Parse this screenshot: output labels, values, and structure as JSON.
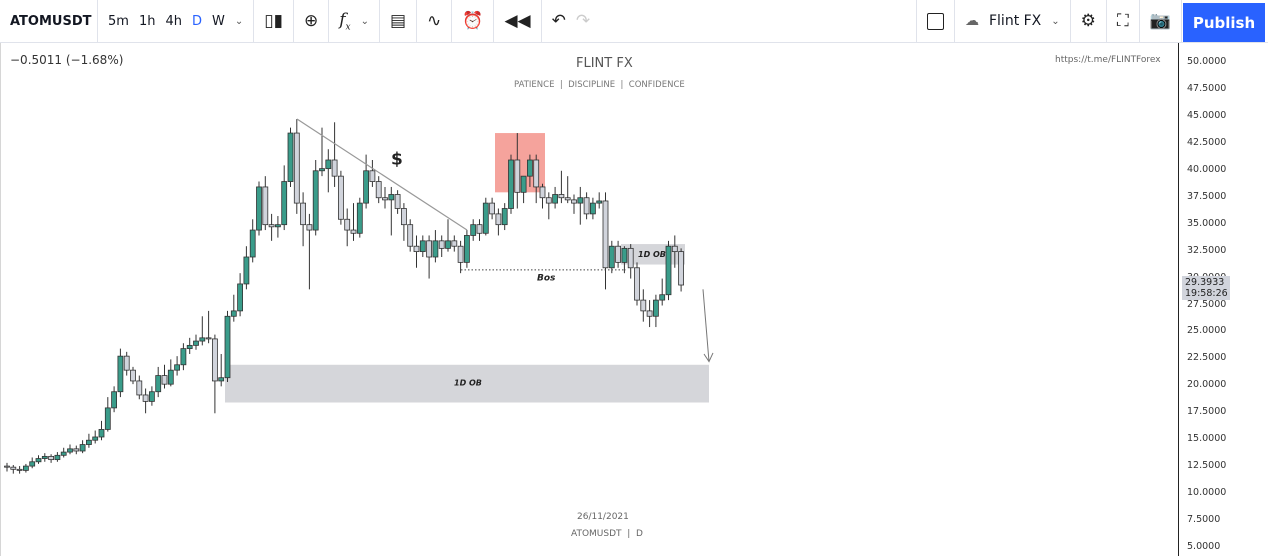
{
  "toolbar": {
    "symbol": "ATOMUSDT",
    "intervals": [
      "5m",
      "1h",
      "4h",
      "D",
      "W"
    ],
    "active_interval": "D",
    "layout_name": "Flint FX",
    "publish": "Publish",
    "icons": [
      "candles-icon",
      "add-compare-icon",
      "indicators-icon",
      "bar-chart-icon",
      "templates-icon",
      "alert-icon",
      "replay-icon",
      "undo-icon",
      "redo-icon",
      "rectangle-icon",
      "cloud-icon",
      "gear-icon",
      "fullscreen-icon",
      "camera-icon"
    ]
  },
  "legend": {
    "change": "−0.5011 (−1.68%)"
  },
  "watermark": {
    "title": "FLINT FX",
    "subtitle": "PATIENCE  |  DISCIPLINE  |  CONFIDENCE",
    "link": "https://t.me/FLINTForex",
    "date": "26/11/2021",
    "symbol_line": "ATOMUSDT  |  D"
  },
  "annotations": {
    "dollar": "$",
    "ob_big": "1D OB",
    "ob_small": "1D OB",
    "bos": "Bos"
  },
  "colors": {
    "up": "#3a9c8a",
    "down": "#d1d4dc",
    "accent": "#2962ff",
    "supply_zone": "#f5a39c",
    "ob_zone": "#d5d6da"
  },
  "chart_data": {
    "type": "candlestick",
    "symbol": "ATOMUSDT",
    "interval": "D",
    "ylim": [
      5,
      50
    ],
    "y_ticks": [
      "50.0000",
      "47.5000",
      "45.0000",
      "42.5000",
      "40.0000",
      "37.5000",
      "35.0000",
      "32.5000",
      "30.0000",
      "27.5000",
      "25.0000",
      "22.5000",
      "20.0000",
      "17.5000",
      "15.0000",
      "12.5000",
      "10.0000",
      "7.5000",
      "5.0000"
    ],
    "last_price": "29.3933",
    "countdown": "19:58:26",
    "ohlc": [
      [
        12.6,
        12.9,
        12.1,
        12.5
      ],
      [
        12.5,
        12.7,
        11.9,
        12.3
      ],
      [
        12.3,
        12.6,
        11.9,
        12.2
      ],
      [
        12.2,
        12.8,
        12.0,
        12.6
      ],
      [
        12.6,
        13.4,
        12.4,
        13.0
      ],
      [
        13.0,
        13.6,
        12.8,
        13.3
      ],
      [
        13.3,
        13.8,
        13.0,
        13.5
      ],
      [
        13.5,
        13.7,
        12.9,
        13.2
      ],
      [
        13.2,
        13.9,
        13.0,
        13.6
      ],
      [
        13.6,
        14.3,
        13.4,
        13.9
      ],
      [
        13.9,
        14.6,
        13.7,
        14.2
      ],
      [
        14.2,
        14.5,
        13.7,
        14.0
      ],
      [
        14.0,
        15.0,
        13.8,
        14.6
      ],
      [
        14.6,
        15.6,
        14.3,
        15.0
      ],
      [
        15.0,
        15.9,
        14.7,
        15.3
      ],
      [
        15.3,
        16.8,
        15.0,
        16.0
      ],
      [
        16.0,
        19.0,
        15.8,
        18.0
      ],
      [
        18.0,
        20.0,
        17.6,
        19.5
      ],
      [
        19.5,
        23.5,
        19.0,
        22.8
      ],
      [
        22.8,
        23.2,
        21.0,
        21.5
      ],
      [
        21.5,
        21.8,
        20.2,
        20.5
      ],
      [
        20.5,
        21.0,
        18.8,
        19.2
      ],
      [
        19.2,
        19.8,
        17.5,
        18.6
      ],
      [
        18.6,
        20.0,
        18.2,
        19.5
      ],
      [
        19.5,
        21.8,
        19.0,
        21.0
      ],
      [
        21.0,
        22.0,
        19.8,
        20.2
      ],
      [
        20.2,
        22.5,
        20.0,
        21.5
      ],
      [
        21.5,
        22.8,
        21.0,
        22.0
      ],
      [
        22.0,
        24.0,
        21.5,
        23.5
      ],
      [
        23.5,
        24.5,
        23.0,
        23.8
      ],
      [
        23.8,
        24.8,
        23.4,
        24.2
      ],
      [
        24.2,
        26.5,
        23.8,
        24.5
      ],
      [
        24.5,
        27.0,
        24.0,
        24.4
      ],
      [
        24.4,
        24.8,
        17.5,
        20.5
      ],
      [
        20.5,
        23.0,
        20.0,
        20.8
      ],
      [
        20.8,
        27.0,
        20.4,
        26.5
      ],
      [
        26.5,
        28.5,
        26.0,
        27.0
      ],
      [
        27.0,
        30.5,
        26.5,
        29.5
      ],
      [
        29.5,
        33.0,
        29.0,
        32.0
      ],
      [
        32.0,
        35.5,
        31.5,
        34.5
      ],
      [
        34.5,
        39.0,
        34.0,
        38.5
      ],
      [
        38.5,
        39.5,
        34.5,
        35.0
      ],
      [
        35.0,
        36.0,
        33.5,
        34.8
      ],
      [
        34.8,
        35.8,
        33.8,
        35.0
      ],
      [
        35.0,
        40.5,
        34.5,
        39.0
      ],
      [
        39.0,
        44.0,
        38.5,
        43.5
      ],
      [
        43.5,
        44.8,
        36.0,
        37.0
      ],
      [
        37.0,
        38.0,
        33.0,
        35.0
      ],
      [
        35.0,
        36.0,
        29.0,
        34.5
      ],
      [
        34.5,
        41.0,
        34.0,
        40.0
      ],
      [
        40.0,
        44.0,
        39.5,
        40.2
      ],
      [
        40.2,
        42.0,
        38.0,
        41.0
      ],
      [
        41.0,
        44.5,
        38.5,
        39.5
      ],
      [
        39.5,
        40.0,
        35.0,
        35.5
      ],
      [
        35.5,
        36.5,
        33.0,
        34.5
      ],
      [
        34.5,
        37.0,
        33.5,
        34.2
      ],
      [
        34.2,
        37.5,
        33.8,
        37.0
      ],
      [
        37.0,
        41.5,
        36.5,
        40.0
      ],
      [
        40.0,
        41.0,
        38.5,
        39.0
      ],
      [
        39.0,
        39.5,
        37.0,
        37.5
      ],
      [
        37.5,
        38.5,
        36.5,
        37.3
      ],
      [
        37.3,
        38.5,
        34.0,
        37.8
      ],
      [
        37.8,
        38.2,
        36.0,
        36.5
      ],
      [
        36.5,
        37.0,
        33.5,
        35.0
      ],
      [
        35.0,
        35.5,
        32.5,
        33.0
      ],
      [
        33.0,
        34.0,
        31.0,
        32.5
      ],
      [
        32.5,
        34.0,
        32.0,
        33.5
      ],
      [
        33.5,
        34.0,
        30.0,
        32.0
      ],
      [
        32.0,
        34.5,
        31.5,
        33.5
      ],
      [
        33.5,
        34.0,
        32.0,
        32.8
      ],
      [
        32.8,
        35.5,
        32.5,
        33.5
      ],
      [
        33.5,
        34.0,
        32.5,
        33.0
      ],
      [
        33.0,
        33.5,
        30.5,
        31.5
      ],
      [
        31.5,
        34.5,
        31.0,
        34.0
      ],
      [
        34.0,
        35.5,
        33.5,
        35.0
      ],
      [
        35.0,
        35.5,
        33.5,
        34.2
      ],
      [
        34.2,
        37.5,
        34.0,
        37.0
      ],
      [
        37.0,
        37.5,
        35.5,
        36.0
      ],
      [
        36.0,
        36.5,
        34.0,
        35.0
      ],
      [
        35.0,
        37.0,
        34.5,
        36.5
      ],
      [
        36.5,
        41.5,
        36.0,
        41.0
      ],
      [
        41.0,
        43.5,
        36.5,
        38.0
      ],
      [
        38.0,
        39.5,
        37.0,
        39.5
      ],
      [
        39.5,
        41.5,
        38.5,
        41.0
      ],
      [
        41.0,
        41.5,
        37.0,
        38.5
      ],
      [
        38.5,
        38.8,
        36.5,
        37.5
      ],
      [
        37.5,
        38.0,
        35.5,
        37.0
      ],
      [
        37.0,
        38.5,
        36.5,
        37.8
      ],
      [
        37.8,
        40.0,
        37.0,
        37.5
      ],
      [
        37.5,
        39.5,
        37.0,
        37.3
      ],
      [
        37.3,
        37.8,
        36.0,
        37.0
      ],
      [
        37.0,
        38.5,
        35.0,
        37.5
      ],
      [
        37.5,
        38.0,
        35.5,
        36.0
      ],
      [
        36.0,
        37.5,
        35.5,
        37.0
      ],
      [
        37.0,
        38.0,
        36.5,
        37.2
      ],
      [
        37.2,
        38.0,
        29.0,
        31.0
      ],
      [
        31.0,
        33.5,
        30.5,
        33.0
      ],
      [
        33.0,
        33.5,
        31.0,
        31.5
      ],
      [
        31.5,
        33.0,
        30.5,
        32.8
      ],
      [
        32.8,
        33.2,
        30.0,
        31.0
      ],
      [
        31.0,
        31.5,
        27.5,
        28.0
      ],
      [
        28.0,
        29.0,
        26.0,
        27.0
      ],
      [
        27.0,
        28.0,
        25.5,
        26.5
      ],
      [
        26.5,
        28.5,
        25.5,
        28.0
      ],
      [
        28.0,
        30.0,
        27.5,
        28.5
      ],
      [
        28.5,
        33.5,
        28.0,
        33.0
      ],
      [
        33.0,
        34.0,
        31.0,
        32.5
      ],
      [
        32.5,
        32.8,
        28.8,
        29.4
      ]
    ]
  }
}
